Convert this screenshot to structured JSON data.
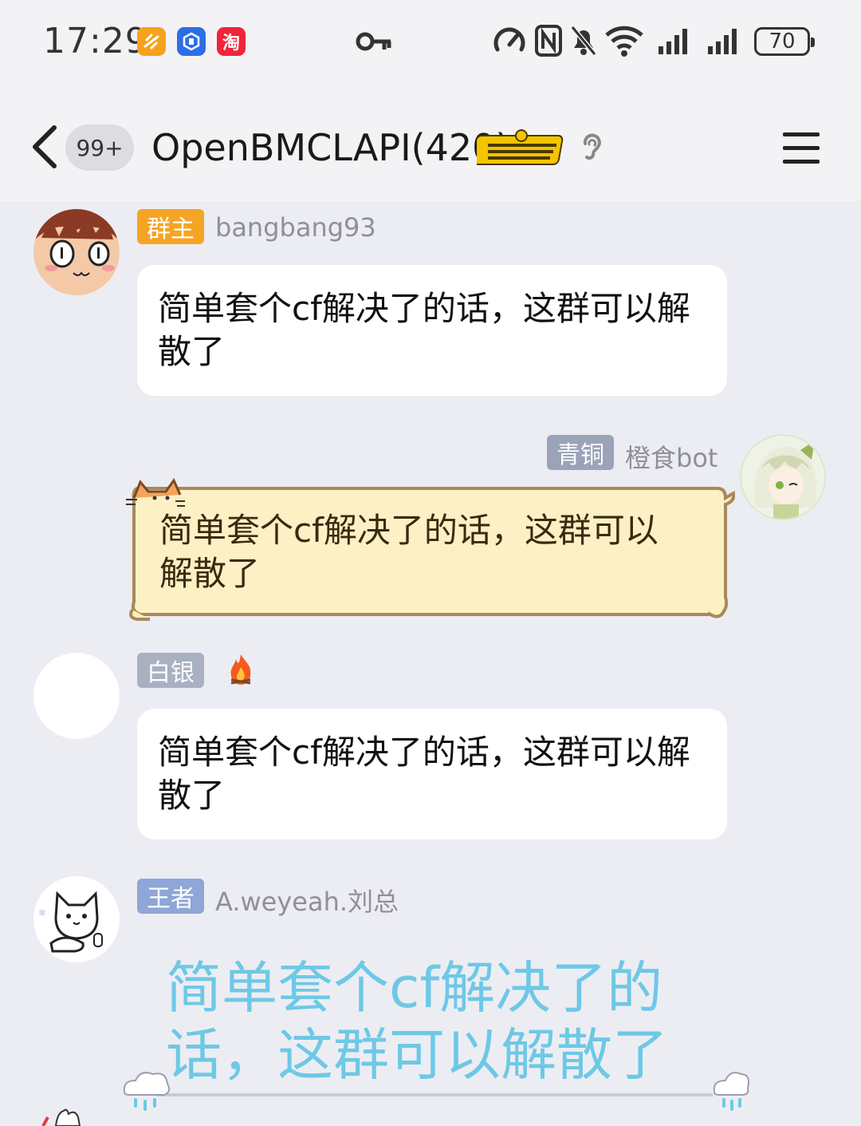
{
  "status_bar": {
    "time": "17:29",
    "battery": "70",
    "apps": [
      {
        "icon": "orange-app-icon",
        "color": "#f6a21d"
      },
      {
        "icon": "blue-app-icon",
        "color": "#2b6ee8"
      },
      {
        "icon": "taobao-app-icon",
        "color": "#f0243a",
        "label": "淘"
      }
    ]
  },
  "header": {
    "unread": "99+",
    "title": "OpenBMCLAPI(420)",
    "badge_text": "Epiphany"
  },
  "messages": [
    {
      "tag": "群主",
      "tag_color": "#f5a524",
      "nick": "bangbang93",
      "text": "简单套个cf解决了的话，这群可以解散了"
    },
    {
      "tag": "青铜",
      "tag_color": "#9aa3b8",
      "nick": "橙食bot",
      "text": "简单套个cf解决了的话，这群可以解散了"
    },
    {
      "tag": "白银",
      "tag_color": "#a9b0c2",
      "nick": "",
      "text": " 简单套个cf解决了的话，这群可以解散了"
    },
    {
      "tag": "王者",
      "tag_color": "#8ea6d8",
      "nick": "A.weyeah.刘总",
      "text": "简单套个cf解决了的话，这群可以解散了"
    }
  ],
  "colors": {
    "background": "#ecedf3",
    "header_bg": "#f3f3f6",
    "cat_bubble_fill": "#fdf0c4",
    "cat_bubble_stroke": "#a88a5a",
    "cyan_text": "#6ec8e6"
  }
}
